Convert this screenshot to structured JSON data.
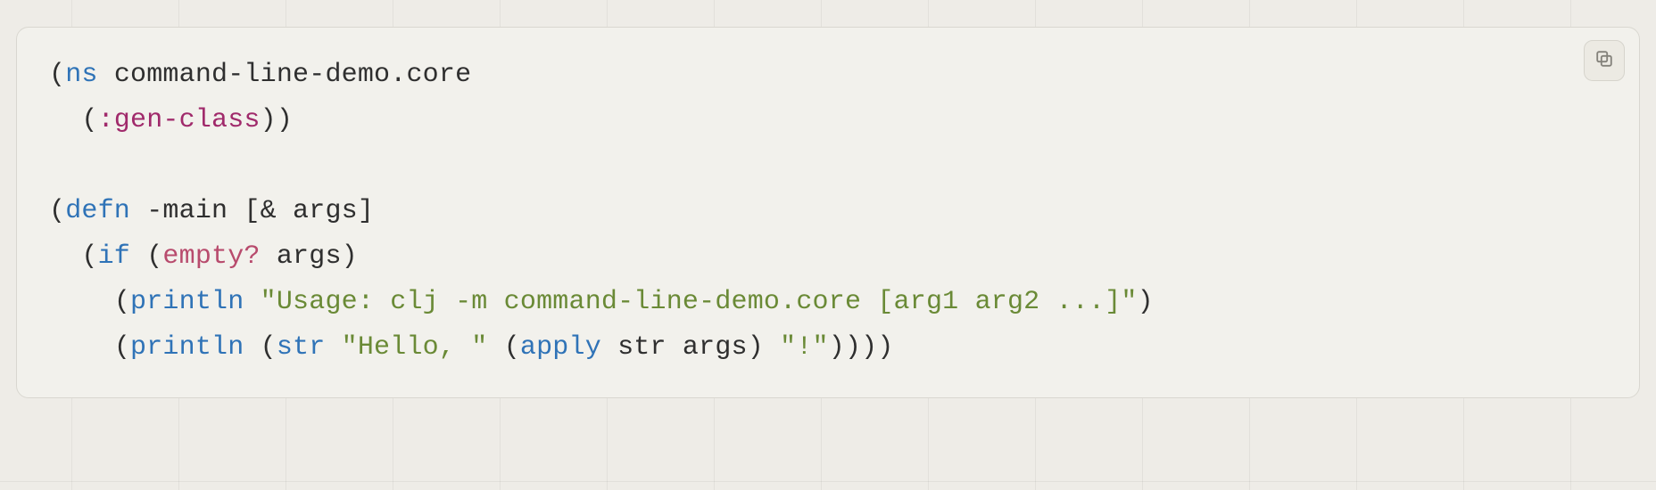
{
  "code": {
    "line1": {
      "open": "(",
      "kw": "ns",
      "sp": " ",
      "rest": "command-line-demo.core"
    },
    "line2": {
      "indent": "  ",
      "open": "(",
      "kw": ":gen-class",
      "close1": ")",
      "close2": ")"
    },
    "line3": "",
    "line4": {
      "open": "(",
      "kw": "defn",
      "sp1": " ",
      "name": "-main",
      "sp2": " ",
      "lbrack": "[",
      "amp": "&",
      "sp3": " ",
      "arg": "args",
      "rbrack": "]"
    },
    "line5": {
      "indent": "  ",
      "open": "(",
      "kw": "if",
      "sp1": " ",
      "open2": "(",
      "fn": "empty?",
      "sp2": " ",
      "arg": "args",
      "close": ")"
    },
    "line6": {
      "indent": "    ",
      "open": "(",
      "fn": "println",
      "sp": " ",
      "str": "\"Usage: clj -m command-line-demo.core [arg1 arg2 ...]\"",
      "close": ")"
    },
    "line7": {
      "indent": "    ",
      "open1": "(",
      "fn1": "println",
      "sp1": " ",
      "open2": "(",
      "fn2": "str",
      "sp2": " ",
      "str1": "\"Hello, \"",
      "sp3": " ",
      "open3": "(",
      "fn3": "apply",
      "sp4": " ",
      "arg1": "str",
      "sp5": " ",
      "arg2": "args",
      "close3": ")",
      "sp6": " ",
      "str2": "\"!\"",
      "close2": ")",
      "close1": ")",
      "close0a": ")",
      "close0b": ")"
    }
  },
  "copy": {
    "tooltip": "Copy"
  },
  "colors": {
    "bg": "#eeece7",
    "card": "#f2f1ec",
    "border": "#d9d7d0",
    "special": "#2f73b7",
    "keyword": "#a02a6b",
    "builtin": "#b84b6d",
    "string": "#6a8a36",
    "text": "#2f2f2f"
  }
}
